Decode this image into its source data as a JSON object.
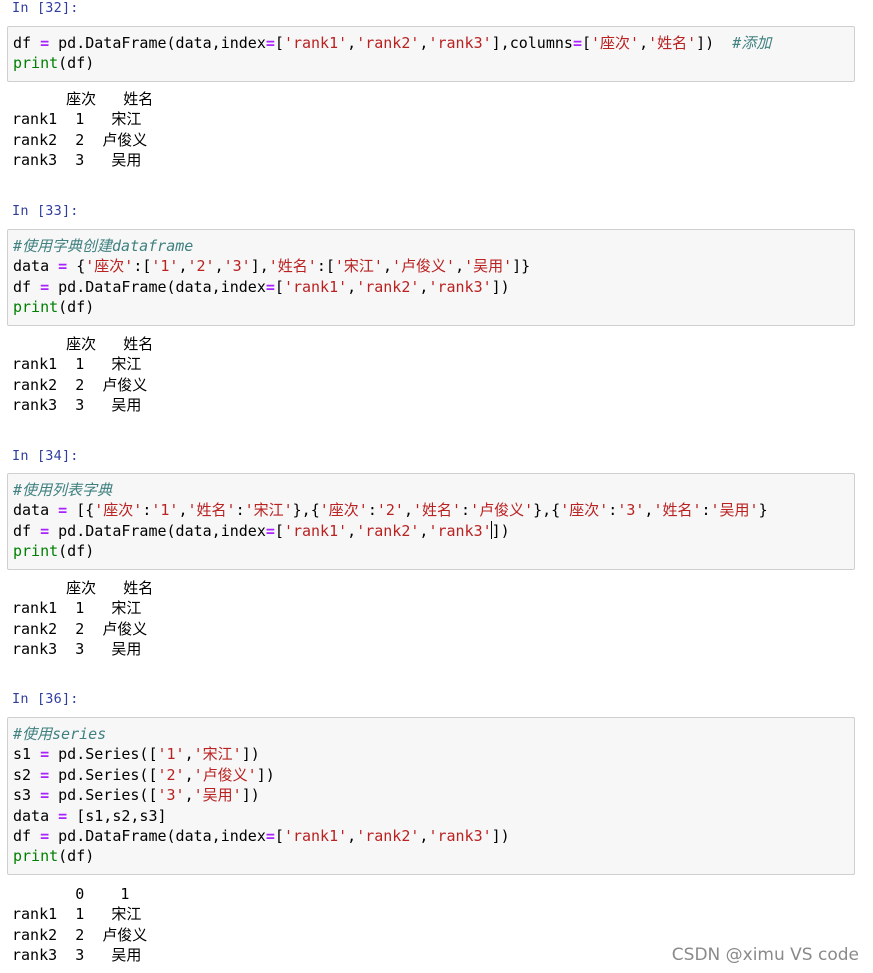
{
  "cells": [
    {
      "prompt": "In [32]:",
      "code": [
        [
          [
            "df ",
            "n"
          ],
          [
            "=",
            "op"
          ],
          [
            " pd.DataFrame(data,index",
            "n"
          ],
          [
            "=",
            "op"
          ],
          [
            "[",
            "n"
          ],
          [
            "'rank1'",
            "st"
          ],
          [
            ",",
            "n"
          ],
          [
            "'rank2'",
            "st"
          ],
          [
            ",",
            "n"
          ],
          [
            "'rank3'",
            "st"
          ],
          [
            "],columns",
            "n"
          ],
          [
            "=",
            "op"
          ],
          [
            "[",
            "n"
          ],
          [
            "'座次'",
            "st"
          ],
          [
            ",",
            "n"
          ],
          [
            "'姓名'",
            "st"
          ],
          [
            "])  ",
            "n"
          ],
          [
            "#添加",
            "cm"
          ]
        ],
        [
          [
            "print",
            "kw"
          ],
          [
            "(df)",
            "n"
          ]
        ]
      ],
      "output": [
        "      座次   姓名",
        "rank1  1   宋江",
        "rank2  2  卢俊义",
        "rank3  3   吴用"
      ]
    },
    {
      "prompt": "In [33]:",
      "code": [
        [
          [
            "#使用字典创建dataframe",
            "cm"
          ]
        ],
        [
          [
            "data ",
            "n"
          ],
          [
            "=",
            "op"
          ],
          [
            " {",
            "n"
          ],
          [
            "'座次'",
            "st"
          ],
          [
            ":[",
            "n"
          ],
          [
            "'1'",
            "st"
          ],
          [
            ",",
            "n"
          ],
          [
            "'2'",
            "st"
          ],
          [
            ",",
            "n"
          ],
          [
            "'3'",
            "st"
          ],
          [
            "],",
            "n"
          ],
          [
            "'姓名'",
            "st"
          ],
          [
            ":[",
            "n"
          ],
          [
            "'宋江'",
            "st"
          ],
          [
            ",",
            "n"
          ],
          [
            "'卢俊义'",
            "st"
          ],
          [
            ",",
            "n"
          ],
          [
            "'吴用'",
            "st"
          ],
          [
            "]}",
            "n"
          ]
        ],
        [
          [
            "df ",
            "n"
          ],
          [
            "=",
            "op"
          ],
          [
            " pd.DataFrame(data,index",
            "n"
          ],
          [
            "=",
            "op"
          ],
          [
            "[",
            "n"
          ],
          [
            "'rank1'",
            "st"
          ],
          [
            ",",
            "n"
          ],
          [
            "'rank2'",
            "st"
          ],
          [
            ",",
            "n"
          ],
          [
            "'rank3'",
            "st"
          ],
          [
            "])",
            "n"
          ]
        ],
        [
          [
            "print",
            "kw"
          ],
          [
            "(df)",
            "n"
          ]
        ]
      ],
      "output": [
        "      座次   姓名",
        "rank1  1   宋江",
        "rank2  2  卢俊义",
        "rank3  3   吴用"
      ]
    },
    {
      "prompt": "In [34]:",
      "code": [
        [
          [
            "#使用列表字典",
            "cm"
          ]
        ],
        [
          [
            "data ",
            "n"
          ],
          [
            "=",
            "op"
          ],
          [
            " [{",
            "n"
          ],
          [
            "'座次'",
            "st"
          ],
          [
            ":",
            "n"
          ],
          [
            "'1'",
            "st"
          ],
          [
            ",",
            "n"
          ],
          [
            "'姓名'",
            "st"
          ],
          [
            ":",
            "n"
          ],
          [
            "'宋江'",
            "st"
          ],
          [
            "},{",
            "n"
          ],
          [
            "'座次'",
            "st"
          ],
          [
            ":",
            "n"
          ],
          [
            "'2'",
            "st"
          ],
          [
            ",",
            "n"
          ],
          [
            "'姓名'",
            "st"
          ],
          [
            ":",
            "n"
          ],
          [
            "'卢俊义'",
            "st"
          ],
          [
            "},{",
            "n"
          ],
          [
            "'座次'",
            "st"
          ],
          [
            ":",
            "n"
          ],
          [
            "'3'",
            "st"
          ],
          [
            ",",
            "n"
          ],
          [
            "'姓名'",
            "st"
          ],
          [
            ":",
            "n"
          ],
          [
            "'吴用'",
            "st"
          ],
          [
            "}",
            "n"
          ]
        ],
        [
          [
            "df ",
            "n"
          ],
          [
            "=",
            "op"
          ],
          [
            " pd.DataFrame(data,index",
            "n"
          ],
          [
            "=",
            "op"
          ],
          [
            "[",
            "n"
          ],
          [
            "'rank1'",
            "st"
          ],
          [
            ",",
            "n"
          ],
          [
            "'rank2'",
            "st"
          ],
          [
            ",",
            "n"
          ],
          [
            "'rank3'",
            "st"
          ],
          [
            "|",
            "cursor"
          ],
          [
            "])",
            "n"
          ]
        ],
        [
          [
            "print",
            "kw"
          ],
          [
            "(df)",
            "n"
          ]
        ]
      ],
      "output": [
        "      座次   姓名",
        "rank1  1   宋江",
        "rank2  2  卢俊义",
        "rank3  3   吴用"
      ]
    },
    {
      "prompt": "In [36]:",
      "code": [
        [
          [
            "#使用series",
            "cm"
          ]
        ],
        [
          [
            "s1 ",
            "n"
          ],
          [
            "=",
            "op"
          ],
          [
            " pd.Series([",
            "n"
          ],
          [
            "'1'",
            "st"
          ],
          [
            ",",
            "n"
          ],
          [
            "'宋江'",
            "st"
          ],
          [
            "])",
            "n"
          ]
        ],
        [
          [
            "s2 ",
            "n"
          ],
          [
            "=",
            "op"
          ],
          [
            " pd.Series([",
            "n"
          ],
          [
            "'2'",
            "st"
          ],
          [
            ",",
            "n"
          ],
          [
            "'卢俊义'",
            "st"
          ],
          [
            "])",
            "n"
          ]
        ],
        [
          [
            "s3 ",
            "n"
          ],
          [
            "=",
            "op"
          ],
          [
            " pd.Series([",
            "n"
          ],
          [
            "'3'",
            "st"
          ],
          [
            ",",
            "n"
          ],
          [
            "'吴用'",
            "st"
          ],
          [
            "])",
            "n"
          ]
        ],
        [
          [
            "data ",
            "n"
          ],
          [
            "=",
            "op"
          ],
          [
            " [s1,s2,s3]",
            "n"
          ]
        ],
        [
          [
            "df ",
            "n"
          ],
          [
            "=",
            "op"
          ],
          [
            " pd.DataFrame(data,index",
            "n"
          ],
          [
            "=",
            "op"
          ],
          [
            "[",
            "n"
          ],
          [
            "'rank1'",
            "st"
          ],
          [
            ",",
            "n"
          ],
          [
            "'rank2'",
            "st"
          ],
          [
            ",",
            "n"
          ],
          [
            "'rank3'",
            "st"
          ],
          [
            "])",
            "n"
          ]
        ],
        [
          [
            "print",
            "kw"
          ],
          [
            "(df)",
            "n"
          ]
        ]
      ],
      "output": [
        "       0    1",
        "rank1  1   宋江",
        "rank2  2  卢俊义",
        "rank3  3   吴用"
      ]
    }
  ],
  "watermark": "CSDN @ximu VS code"
}
